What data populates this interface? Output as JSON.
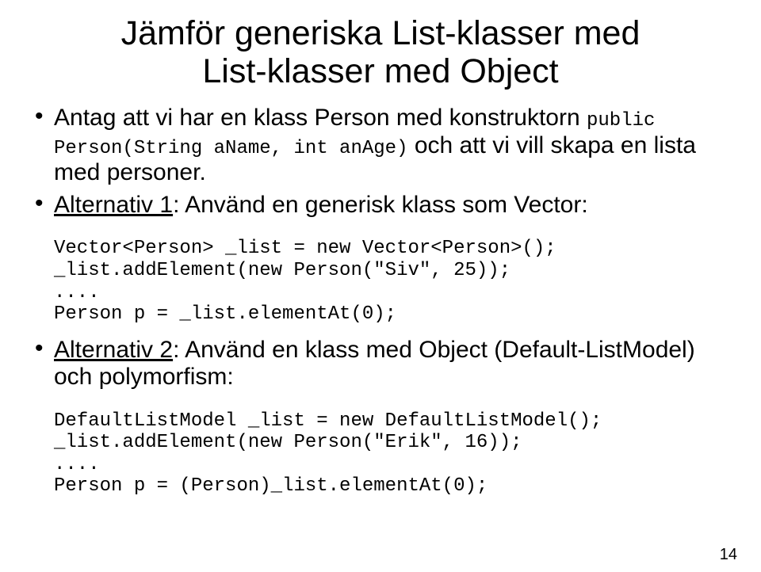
{
  "title_line1": "Jämför generiska List-klasser med",
  "title_line2": "List-klasser med Object",
  "bullet1_part1": "Antag att vi har en klass Person med konstruktorn ",
  "bullet1_code": "public Person(String aName, int anAge)",
  "bullet1_part2": " och att vi vill skapa en lista med personer.",
  "bullet2_underlined": "Alternativ 1",
  "bullet2_rest": ": Använd en generisk klass som Vector:",
  "code_block1": "Vector<Person> _list = new Vector<Person>();\n_list.addElement(new Person(\"Siv\", 25));\n....\nPerson p = _list.elementAt(0);",
  "bullet3_underlined": "Alternativ 2",
  "bullet3_rest": ": Använd en klass med Object (Default-ListModel) och polymorfism:",
  "code_block2": "DefaultListModel _list = new DefaultListModel();\n_list.addElement(new Person(\"Erik\", 16));\n....\nPerson p = (Person)_list.elementAt(0);",
  "page_number": "14"
}
